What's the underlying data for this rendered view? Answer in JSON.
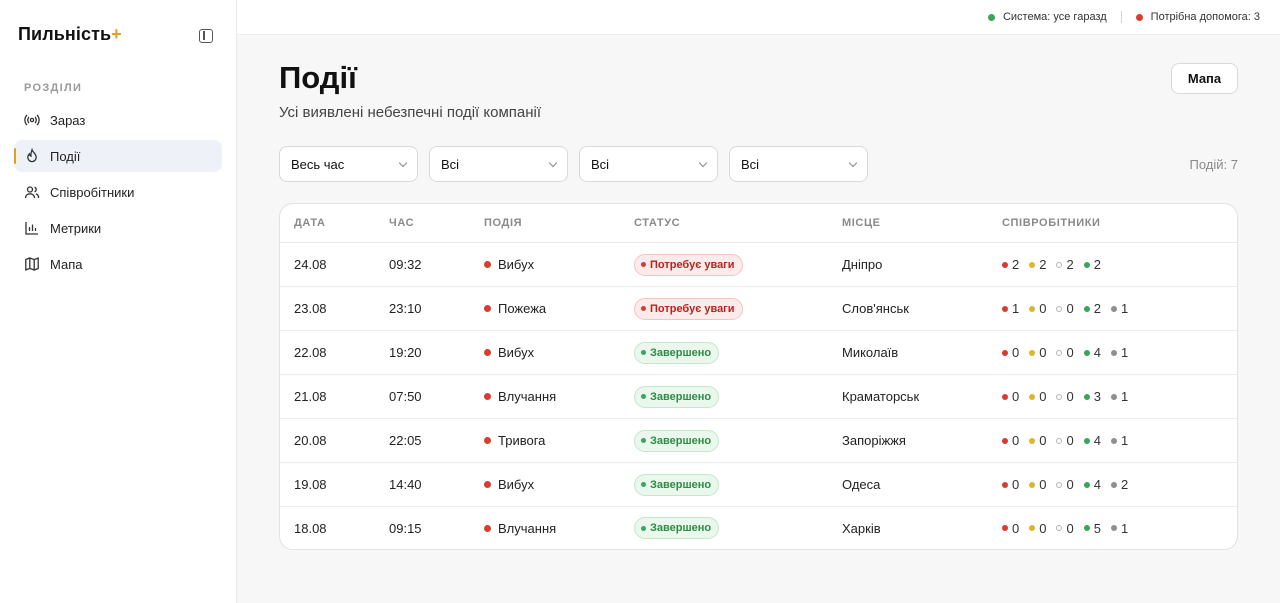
{
  "brand": {
    "name": "Пильність",
    "plus": "+"
  },
  "sidebar": {
    "section_label": "РОЗДІЛИ",
    "items": [
      {
        "label": "Зараз",
        "icon": "broadcast-icon",
        "active": false
      },
      {
        "label": "Події",
        "icon": "flame-icon",
        "active": true
      },
      {
        "label": "Співробітники",
        "icon": "users-icon",
        "active": false
      },
      {
        "label": "Метрики",
        "icon": "bar-chart-icon",
        "active": false
      },
      {
        "label": "Мапа",
        "icon": "map-icon",
        "active": false
      }
    ]
  },
  "topbar": {
    "system_status": "Система: усе гаразд",
    "system_color": "#3aa45a",
    "help_status": "Потрібна допомога: 3",
    "help_color": "#d93b30"
  },
  "page": {
    "title": "Події",
    "subtitle": "Усі виявлені небезпечні події компанії",
    "map_button": "Мапа",
    "events_count": "Подій: 7"
  },
  "filters": [
    "Весь час",
    "Всі",
    "Всі",
    "Всі"
  ],
  "table": {
    "headers": [
      "ДАТА",
      "ЧАС",
      "ПОДІЯ",
      "СТАТУС",
      "МІСЦЕ",
      "СПІВРОБІТНИКИ"
    ],
    "rows": [
      {
        "date": "24.08",
        "time": "09:32",
        "event": "Вибух",
        "status": "Потребує уваги",
        "status_type": "alert",
        "place": "Дніпро",
        "staff": [
          [
            "red",
            "2"
          ],
          [
            "yellow",
            "2"
          ],
          [
            "empty",
            "2"
          ],
          [
            "green",
            "2"
          ]
        ]
      },
      {
        "date": "23.08",
        "time": "23:10",
        "event": "Пожежа",
        "status": "Потребує уваги",
        "status_type": "alert",
        "place": "Слов'янськ",
        "staff": [
          [
            "red",
            "1"
          ],
          [
            "yellow",
            "0"
          ],
          [
            "empty",
            "0"
          ],
          [
            "green",
            "2"
          ],
          [
            "gray",
            "1"
          ]
        ]
      },
      {
        "date": "22.08",
        "time": "19:20",
        "event": "Вибух",
        "status": "Завершено",
        "status_type": "done",
        "place": "Миколаїв",
        "staff": [
          [
            "red",
            "0"
          ],
          [
            "yellow",
            "0"
          ],
          [
            "empty",
            "0"
          ],
          [
            "green",
            "4"
          ],
          [
            "gray",
            "1"
          ]
        ]
      },
      {
        "date": "21.08",
        "time": "07:50",
        "event": "Влучання",
        "status": "Завершено",
        "status_type": "done",
        "place": "Краматорськ",
        "staff": [
          [
            "red",
            "0"
          ],
          [
            "yellow",
            "0"
          ],
          [
            "empty",
            "0"
          ],
          [
            "green",
            "3"
          ],
          [
            "gray",
            "1"
          ]
        ]
      },
      {
        "date": "20.08",
        "time": "22:05",
        "event": "Тривога",
        "status": "Завершено",
        "status_type": "done",
        "place": "Запоріжжя",
        "staff": [
          [
            "red",
            "0"
          ],
          [
            "yellow",
            "0"
          ],
          [
            "empty",
            "0"
          ],
          [
            "green",
            "4"
          ],
          [
            "gray",
            "1"
          ]
        ]
      },
      {
        "date": "19.08",
        "time": "14:40",
        "event": "Вибух",
        "status": "Завершено",
        "status_type": "done",
        "place": "Одеса",
        "staff": [
          [
            "red",
            "0"
          ],
          [
            "yellow",
            "0"
          ],
          [
            "empty",
            "0"
          ],
          [
            "green",
            "4"
          ],
          [
            "gray",
            "2"
          ]
        ]
      },
      {
        "date": "18.08",
        "time": "09:15",
        "event": "Влучання",
        "status": "Завершено",
        "status_type": "done",
        "place": "Харків",
        "staff": [
          [
            "red",
            "0"
          ],
          [
            "yellow",
            "0"
          ],
          [
            "empty",
            "0"
          ],
          [
            "green",
            "5"
          ],
          [
            "gray",
            "1"
          ]
        ]
      }
    ]
  }
}
